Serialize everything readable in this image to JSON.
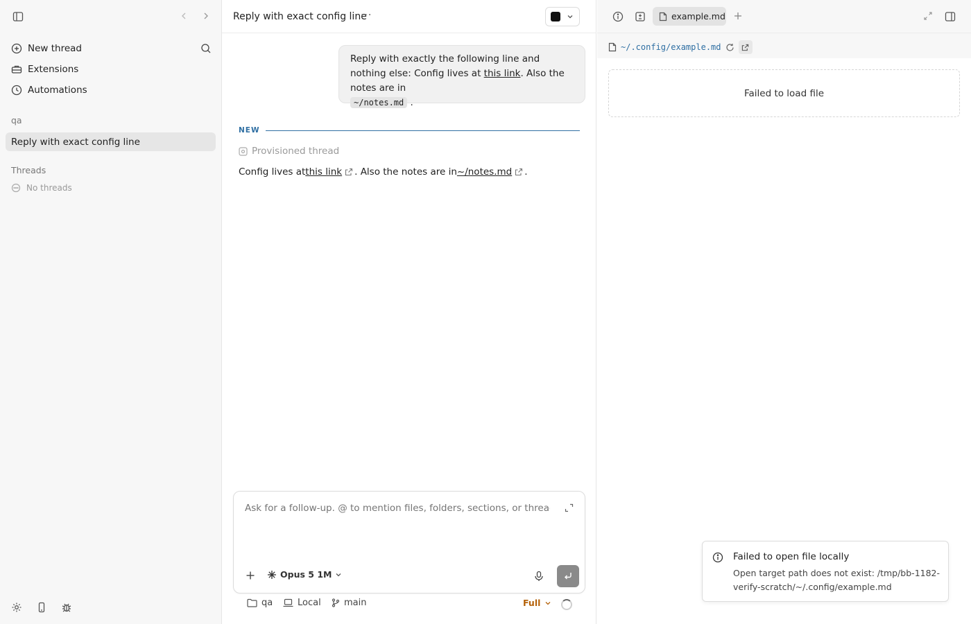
{
  "sidebar": {
    "nav": [
      {
        "label": "New thread",
        "icon": "plus-circle-icon"
      },
      {
        "label": "Extensions",
        "icon": "toolbox-icon"
      },
      {
        "label": "Automations",
        "icon": "clock-icon"
      }
    ],
    "project_label": "qa",
    "active_thread": "Reply with exact config line",
    "threads_label": "Threads",
    "no_threads": "No threads"
  },
  "main": {
    "title": "Reply with exact config line",
    "more": "···",
    "user_message": {
      "part1": "Reply with exactly the following line and nothing else: Config lives at ",
      "link": "this link",
      "part2": ". Also the notes are in ",
      "code": "~/notes.md",
      "part3": " ."
    },
    "new_label": "NEW",
    "provisioned": "Provisioned thread",
    "reply": {
      "part1": "Config lives at ",
      "link1": "this link",
      "part2": ". Also the notes are in ",
      "link2": "~/notes.md",
      "part3": "."
    },
    "composer": {
      "placeholder": "Ask for a follow-up. @ to mention files, folders, sections, or threads",
      "model": "Opus 5 1M"
    },
    "footer": {
      "folder": "qa",
      "env": "Local",
      "branch": "main",
      "mode": "Full"
    }
  },
  "right": {
    "tab_label": "example.md",
    "path": "~/.config/example.md",
    "error": "Failed to load file"
  },
  "toast": {
    "title": "Failed to open file locally",
    "message": "Open target path does not exist: /tmp/bb-1182-verify-scratch/~/.config/example.md"
  },
  "colors": {
    "link_blue": "#2f6fa3",
    "full_orange": "#b5620a"
  }
}
